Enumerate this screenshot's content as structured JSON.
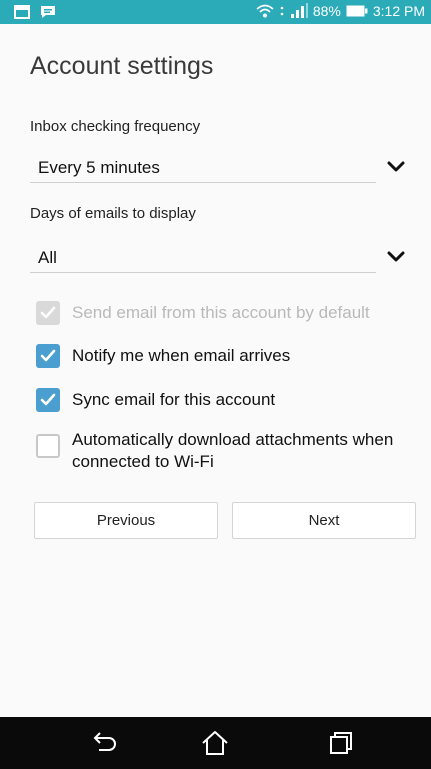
{
  "status_bar": {
    "battery": "88%",
    "time": "3:12 PM",
    "icons": [
      "email-notification-icon",
      "chat-notification-icon",
      "wifi-icon",
      "signal-icon",
      "battery-icon"
    ]
  },
  "page": {
    "title": "Account settings"
  },
  "inbox_frequency": {
    "label": "Inbox checking frequency",
    "selected": "Every 5 minutes"
  },
  "days_to_display": {
    "label": "Days of emails to display",
    "selected": "All"
  },
  "options": [
    {
      "label": "Send email from this account by default",
      "checked": true,
      "enabled": false
    },
    {
      "label": "Notify me when email arrives",
      "checked": true,
      "enabled": true
    },
    {
      "label": "Sync email for this account",
      "checked": true,
      "enabled": true
    },
    {
      "label": "Automatically download attachments when connected to Wi-Fi",
      "checked": false,
      "enabled": true
    }
  ],
  "buttons": {
    "previous": "Previous",
    "next": "Next"
  },
  "colors": {
    "status_bar": "#2baab8",
    "accent": "#4a9fd0",
    "nav_bar": "#0a0a0a"
  },
  "nav_bar": {
    "icons": [
      "back-icon",
      "home-icon",
      "recents-icon"
    ]
  }
}
